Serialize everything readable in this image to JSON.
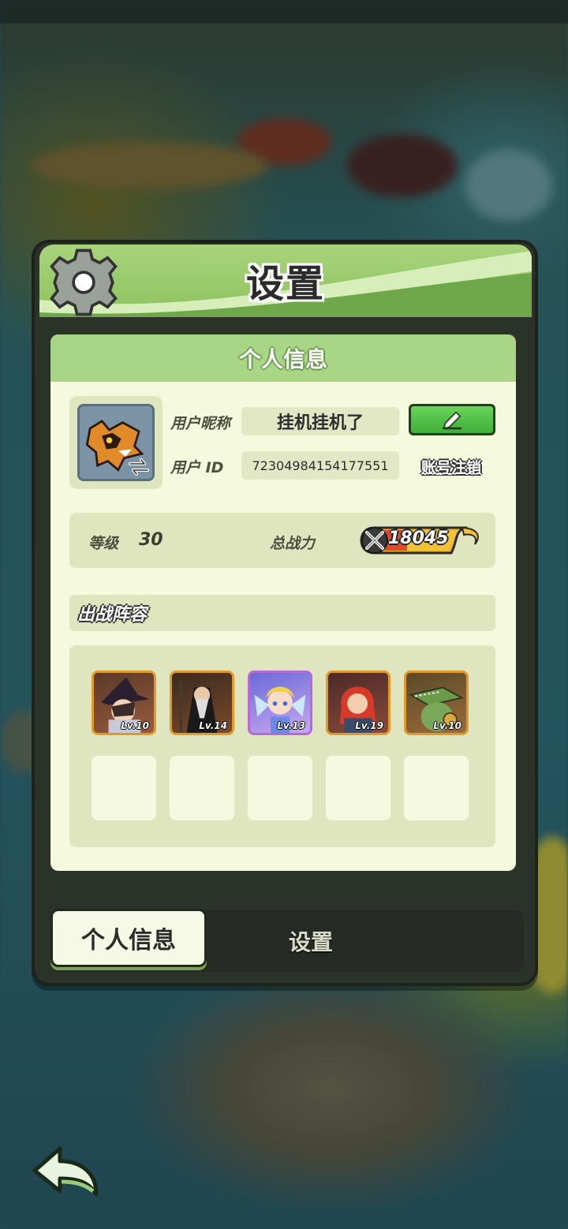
{
  "dialog": {
    "title": "设置"
  },
  "section": {
    "header": "个人信息"
  },
  "profile": {
    "nickname_label": "用户昵称",
    "nickname": "挂机挂机了",
    "id_label": "用户 ID",
    "user_id": "72304984154177551",
    "cancel_account_label": "账号注销"
  },
  "stats": {
    "level_label": "等级",
    "level": "30",
    "power_label": "总战力",
    "power": "18045"
  },
  "lineup": {
    "label": "出战阵容",
    "heroes": [
      {
        "level": "Lv.10",
        "rarity": "orange"
      },
      {
        "level": "Lv.14",
        "rarity": "orange"
      },
      {
        "level": "Lv.13",
        "rarity": "purple"
      },
      {
        "level": "Lv.19",
        "rarity": "orange"
      },
      {
        "level": "Lv.10",
        "rarity": "orange"
      }
    ]
  },
  "tabs": [
    {
      "label": "个人信息",
      "active": true
    },
    {
      "label": "设置",
      "active": false
    }
  ],
  "colors": {
    "header_green": "#8dc15e",
    "edit_button": "#4fbd44",
    "orange_frame": "#e09a2a",
    "purple_frame": "#b66ad8"
  }
}
